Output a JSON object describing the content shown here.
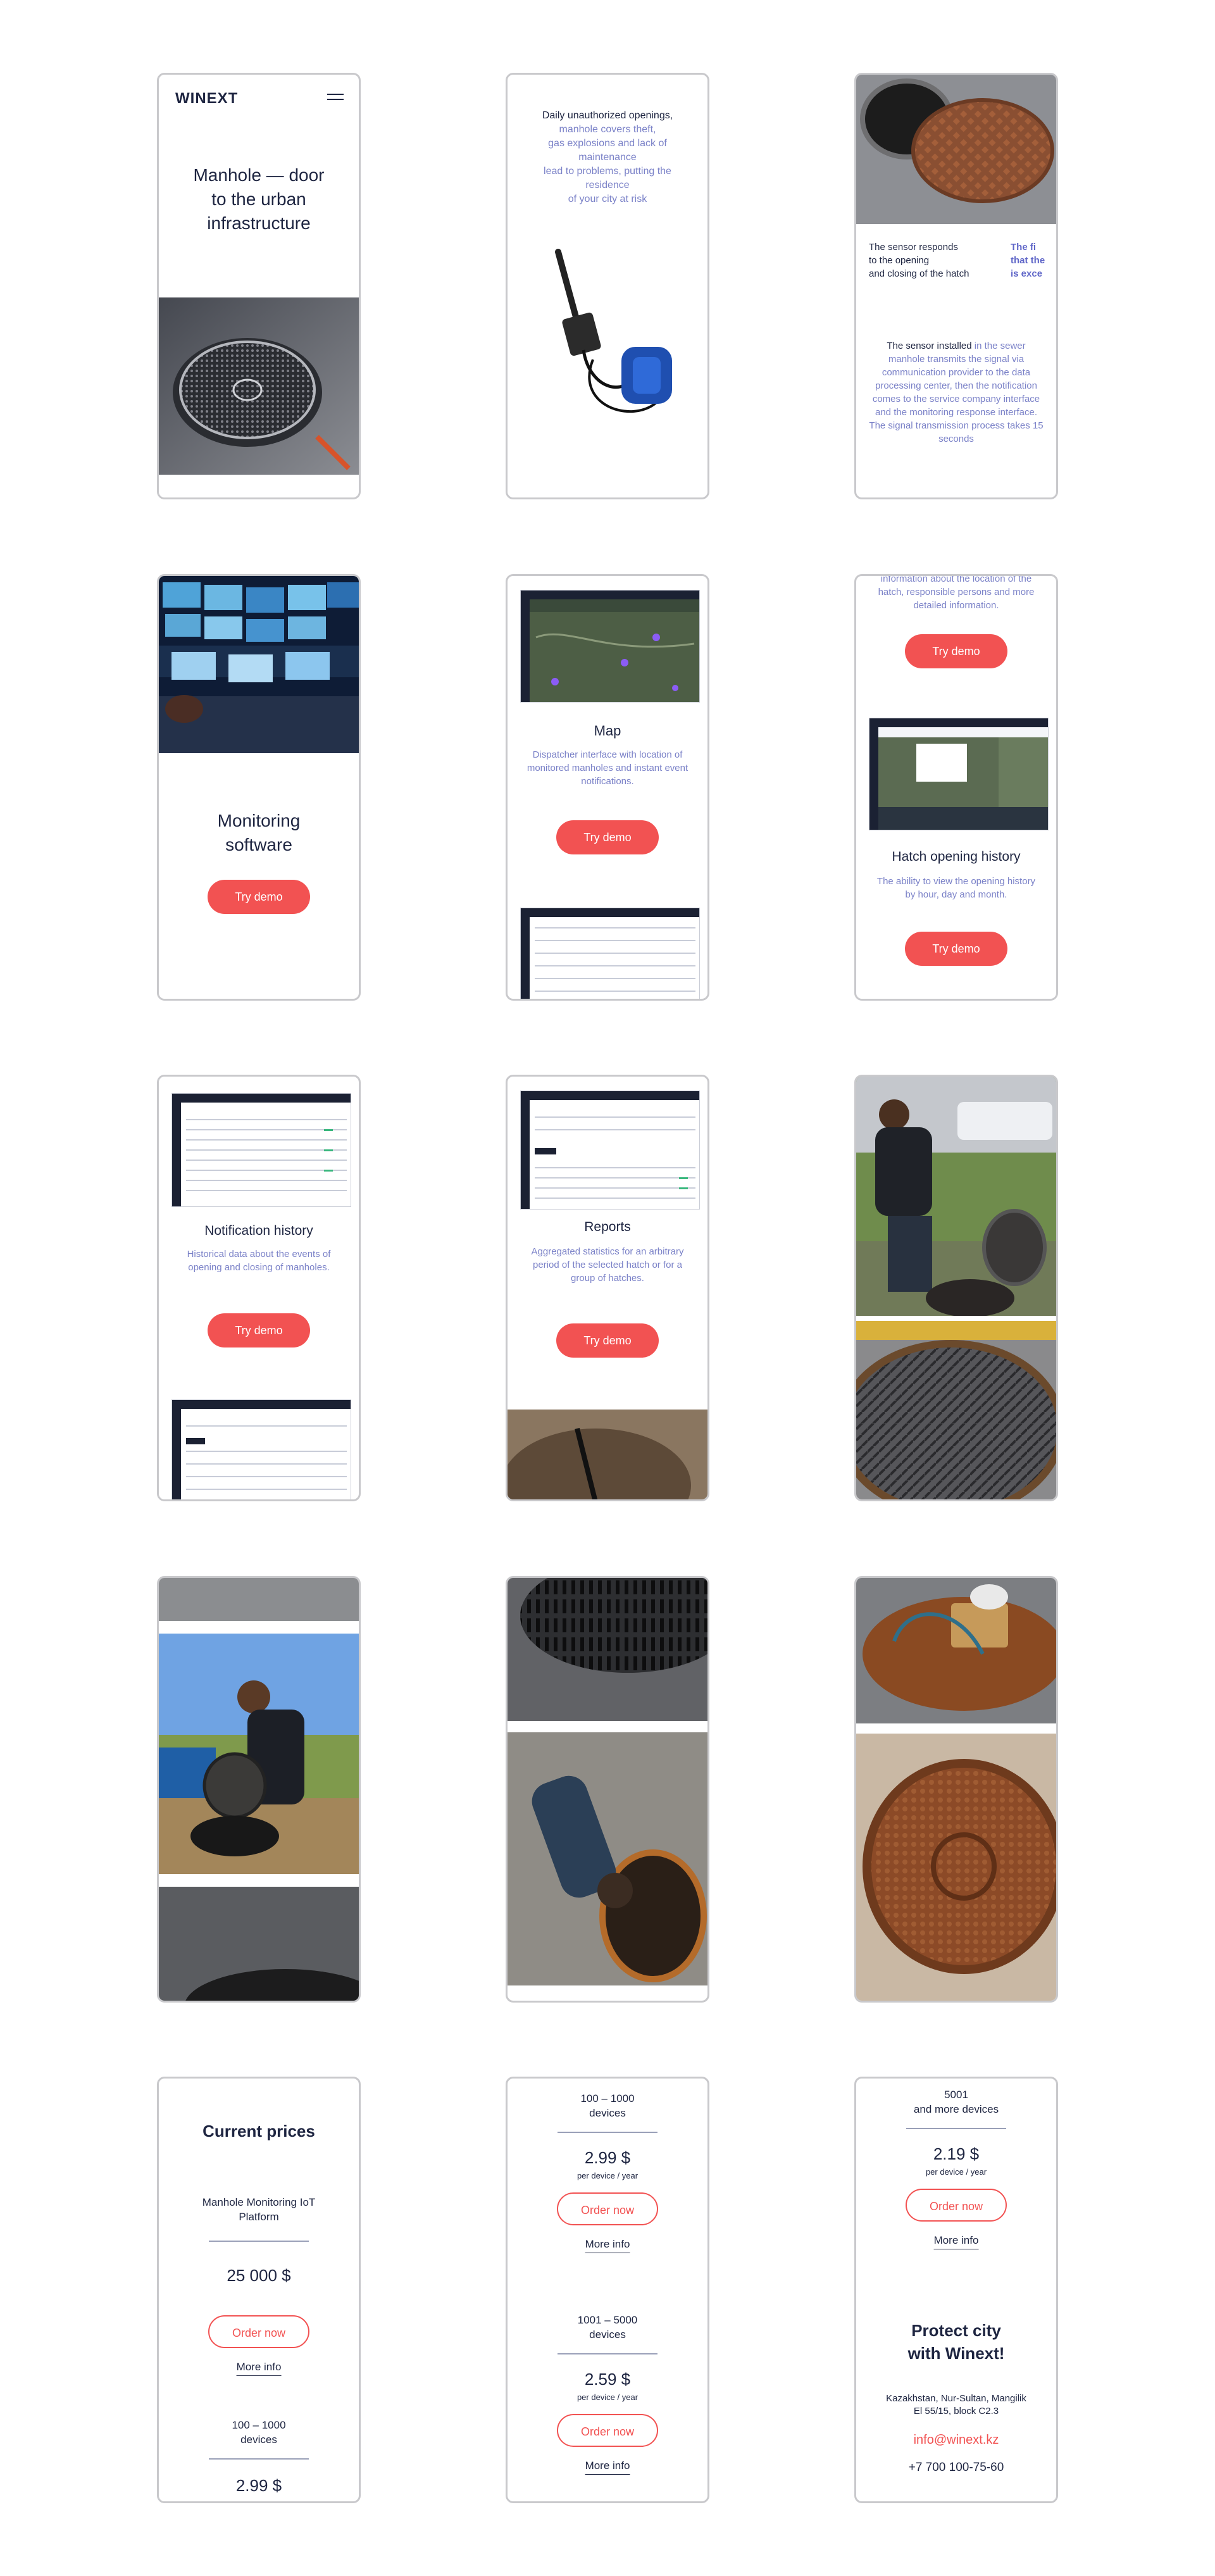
{
  "brand": {
    "logo": "WINEXT"
  },
  "screen1": {
    "headline": "Manhole — door to the urban infrastructure"
  },
  "screen2": {
    "line1": "Daily unauthorized openings,",
    "line2": "manhole covers theft,",
    "line3": "gas explosions and lack of",
    "line4": "maintenance",
    "line5": "lead to problems, putting the",
    "line6": "residence",
    "line7": "of your city at risk"
  },
  "screen3": {
    "responds_1": "The sensor responds",
    "responds_2": "to the opening",
    "responds_3": "and closing of the hatch",
    "cut_1": "The fi",
    "cut_2": "that the",
    "cut_3": "is exce",
    "installed_lead": "The sensor installed",
    "installed_rest": " in the sewer manhole transmits the signal via communication provider to the data processing center, then the notification comes to the service company interface and the monitoring response interface. The signal transmission process takes 15 seconds"
  },
  "screen4": {
    "title": "Monitoring software",
    "cta": "Try demo"
  },
  "screen5": {
    "title": "Map",
    "desc": "Dispatcher interface with location of monitored manholes and instant event notifications.",
    "cta": "Try demo"
  },
  "screen6": {
    "top_text": "information about the location of the hatch, responsible persons and more detailed information.",
    "cta_top": "Try demo",
    "title": "Hatch opening history",
    "desc": "The ability to view the opening history by hour, day and month.",
    "cta": "Try demo"
  },
  "screen7": {
    "title": "Notification history",
    "desc": "Historical data about the events of opening and closing of manholes.",
    "cta": "Try demo"
  },
  "screen8": {
    "title": "Reports",
    "desc": "Aggregated statistics for an arbitrary period of the selected hatch or for a group of hatches.",
    "cta": "Try demo"
  },
  "screen13": {
    "title": "Current prices",
    "platform": "Manhole Monitoring IoT Platform",
    "platform_price": "25 000 $",
    "order": "Order now",
    "more": "More info",
    "tier_label": "100 – 1000 devices",
    "tier_price": "2.99 $"
  },
  "screen14": {
    "tier1_label": "100 – 1000 devices",
    "tier1_price": "2.99 $",
    "per": "per device / year",
    "order": "Order now",
    "more": "More info",
    "tier2_label": "1001 – 5000 devices",
    "tier2_price": "2.59 $"
  },
  "screen15": {
    "tier_label_1": "5001",
    "tier_label_2": "and more devices",
    "tier_price": "2.19 $",
    "per": "per device / year",
    "order": "Order now",
    "more": "More info",
    "protect": "Protect city with Winext!",
    "address": "Kazakhstan, Nur-Sultan, Mangilik El 55/15, block C2.3",
    "email": "info@winext.kz",
    "phone": "+7 700 100-75-60"
  },
  "colors": {
    "accent": "#f25252",
    "navy": "#1e2541",
    "muted_blue": "#7b82c8",
    "frame": "#c9c9cc"
  }
}
